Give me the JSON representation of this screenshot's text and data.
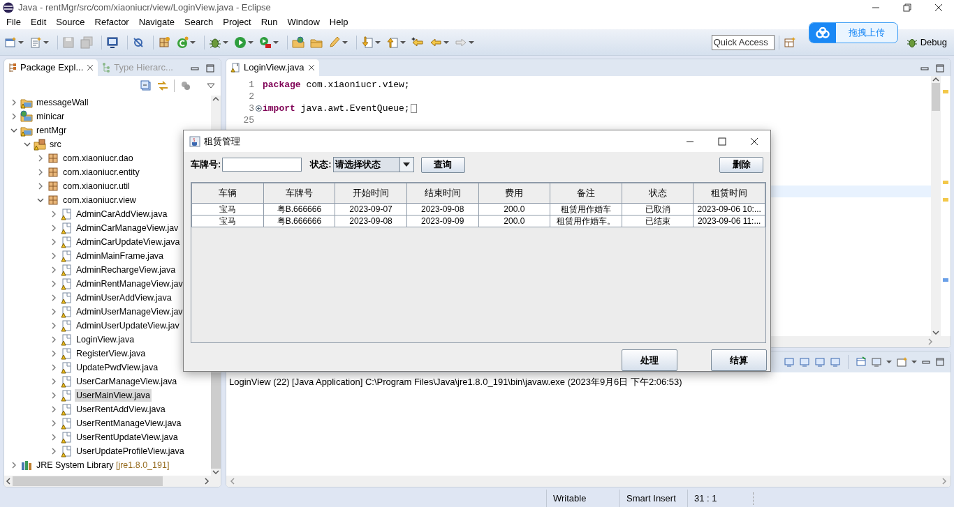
{
  "window": {
    "title": "Java - rentMgr/src/com/xiaoniucr/view/LoginView.java - Eclipse"
  },
  "menu": [
    "File",
    "Edit",
    "Source",
    "Refactor",
    "Navigate",
    "Search",
    "Project",
    "Run",
    "Window",
    "Help"
  ],
  "quick_access": {
    "placeholder": "Quick Access"
  },
  "perspective": {
    "label": "Debug"
  },
  "upload_widget": {
    "label": "拖拽上传"
  },
  "explorer": {
    "tabs": [
      {
        "label": "Package Expl...",
        "selected": true
      },
      {
        "label": "Type Hierarc...",
        "selected": false
      }
    ],
    "tree": [
      {
        "kind": "project",
        "label": "messageWall",
        "expanded": false,
        "selected": false
      },
      {
        "kind": "web-project",
        "label": "minicar",
        "expanded": false,
        "selected": false
      },
      {
        "kind": "project",
        "label": "rentMgr",
        "expanded": true,
        "selected": false,
        "children": [
          {
            "kind": "source-folder",
            "label": "src",
            "expanded": true,
            "selected": false,
            "children": [
              {
                "kind": "package",
                "label": "com.xiaoniucr.dao",
                "expanded": false,
                "selected": false
              },
              {
                "kind": "package",
                "label": "com.xiaoniucr.entity",
                "expanded": false,
                "selected": false
              },
              {
                "kind": "package",
                "label": "com.xiaoniucr.util",
                "expanded": false,
                "selected": false
              },
              {
                "kind": "package",
                "label": "com.xiaoniucr.view",
                "expanded": true,
                "selected": false,
                "children": [
                  {
                    "kind": "java-file",
                    "label": "AdminCarAddView.java",
                    "expanded": false,
                    "selected": false
                  },
                  {
                    "kind": "java-file",
                    "label": "AdminCarManageView.jav",
                    "expanded": false,
                    "selected": false
                  },
                  {
                    "kind": "java-file",
                    "label": "AdminCarUpdateView.java",
                    "expanded": false,
                    "selected": false
                  },
                  {
                    "kind": "java-file",
                    "label": "AdminMainFrame.java",
                    "expanded": false,
                    "selected": false
                  },
                  {
                    "kind": "java-file",
                    "label": "AdminRechargeView.java",
                    "expanded": false,
                    "selected": false
                  },
                  {
                    "kind": "java-file",
                    "label": "AdminRentManageView.jav",
                    "expanded": false,
                    "selected": false
                  },
                  {
                    "kind": "java-file",
                    "label": "AdminUserAddView.java",
                    "expanded": false,
                    "selected": false
                  },
                  {
                    "kind": "java-file",
                    "label": "AdminUserManageView.jav",
                    "expanded": false,
                    "selected": false
                  },
                  {
                    "kind": "java-file",
                    "label": "AdminUserUpdateView.jav",
                    "expanded": false,
                    "selected": false
                  },
                  {
                    "kind": "java-file",
                    "label": "LoginView.java",
                    "expanded": false,
                    "selected": false
                  },
                  {
                    "kind": "java-file",
                    "label": "RegisterView.java",
                    "expanded": false,
                    "selected": false
                  },
                  {
                    "kind": "java-file",
                    "label": "UpdatePwdView.java",
                    "expanded": false,
                    "selected": false
                  },
                  {
                    "kind": "java-file",
                    "label": "UserCarManageView.java",
                    "expanded": false,
                    "selected": false
                  },
                  {
                    "kind": "java-file",
                    "label": "UserMainView.java",
                    "expanded": false,
                    "selected": true
                  },
                  {
                    "kind": "java-file",
                    "label": "UserRentAddView.java",
                    "expanded": false,
                    "selected": false
                  },
                  {
                    "kind": "java-file",
                    "label": "UserRentManageView.java",
                    "expanded": false,
                    "selected": false
                  },
                  {
                    "kind": "java-file",
                    "label": "UserRentUpdateView.java",
                    "expanded": false,
                    "selected": false
                  },
                  {
                    "kind": "java-file",
                    "label": "UserUpdateProfileView.java",
                    "expanded": false,
                    "selected": false
                  }
                ]
              }
            ]
          }
        ]
      },
      {
        "kind": "library",
        "label": "JRE System Library",
        "detail": "[jre1.8.0_191]",
        "expanded": false,
        "selected": false
      }
    ]
  },
  "editor": {
    "tabs": [
      {
        "label": "LoginView.java",
        "selected": true
      }
    ],
    "lines": [
      {
        "number": "1",
        "keyword": "package",
        "code": "com.xiaoniucr.view;"
      },
      {
        "number": "2"
      },
      {
        "number": "3",
        "keyword": "import",
        "code": "java.awt.EventQueue;",
        "folded": true
      },
      {
        "number": "25"
      }
    ]
  },
  "console": {
    "text": "LoginView (22) [Java Application] C:\\Program Files\\Java\\jre1.8.0_191\\bin\\javaw.exe (2023年9月6日 下午2:06:53)"
  },
  "status_bar": [
    "Writable",
    "Smart Insert",
    "31 : 1"
  ],
  "dialog": {
    "title": "租赁管理",
    "plate_label": "车牌号:",
    "status_label": "状态:",
    "status_select": {
      "value": "请选择状态"
    },
    "query_button": "查询",
    "delete_button": "删除",
    "table": {
      "columns": [
        "车辆",
        "车牌号",
        "开始时间",
        "结束时间",
        "费用",
        "备注",
        "状态",
        "租赁时间"
      ],
      "rows": [
        [
          "宝马",
          "粤B.666666",
          "2023-09-07",
          "2023-09-08",
          "200.0",
          "租赁用作婚车",
          "已取消",
          "2023-09-06 10:..."
        ],
        [
          "宝马",
          "粤B.666666",
          "2023-09-08",
          "2023-09-09",
          "200.0",
          "租赁用作婚车。",
          "已结束",
          "2023-09-06 11:..."
        ]
      ]
    },
    "footer_buttons": [
      "处理",
      "结算"
    ]
  }
}
